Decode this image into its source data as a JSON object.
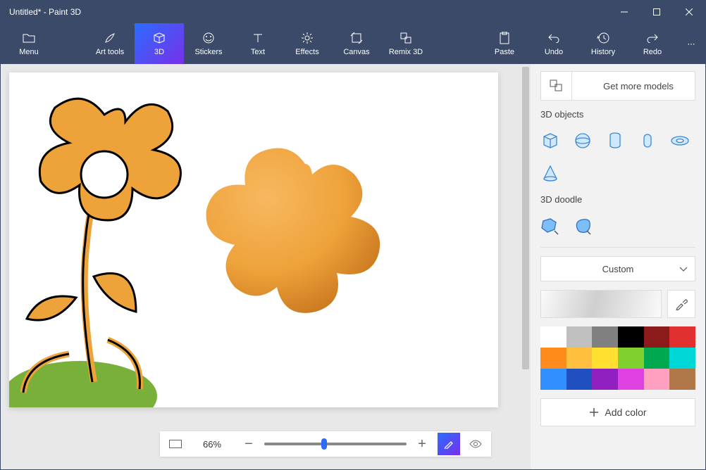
{
  "window": {
    "title": "Untitled* - Paint 3D"
  },
  "ribbon": {
    "menu": "Menu",
    "art": "Art tools",
    "threeD": "3D",
    "stickers": "Stickers",
    "text": "Text",
    "effects": "Effects",
    "canvas": "Canvas",
    "remix": "Remix 3D",
    "paste": "Paste",
    "undo": "Undo",
    "history": "History",
    "redo": "Redo",
    "more": "⋯"
  },
  "zoom": {
    "pct": "66%",
    "minus": "−",
    "plus": "+"
  },
  "panel": {
    "getModels": "Get more models",
    "objects": "3D objects",
    "doodle": "3D doodle",
    "custom": "Custom",
    "addColor": "Add color"
  },
  "palette": [
    "#ffffff",
    "#c0c0c0",
    "#808080",
    "#000000",
    "#8b1a1a",
    "#e03030",
    "#ff8c1a",
    "#ffc040",
    "#ffe030",
    "#80d030",
    "#00a850",
    "#00d8d8",
    "#3090ff",
    "#2050c0",
    "#9020c0",
    "#e040e0",
    "#ffa0c0",
    "#b07848"
  ]
}
